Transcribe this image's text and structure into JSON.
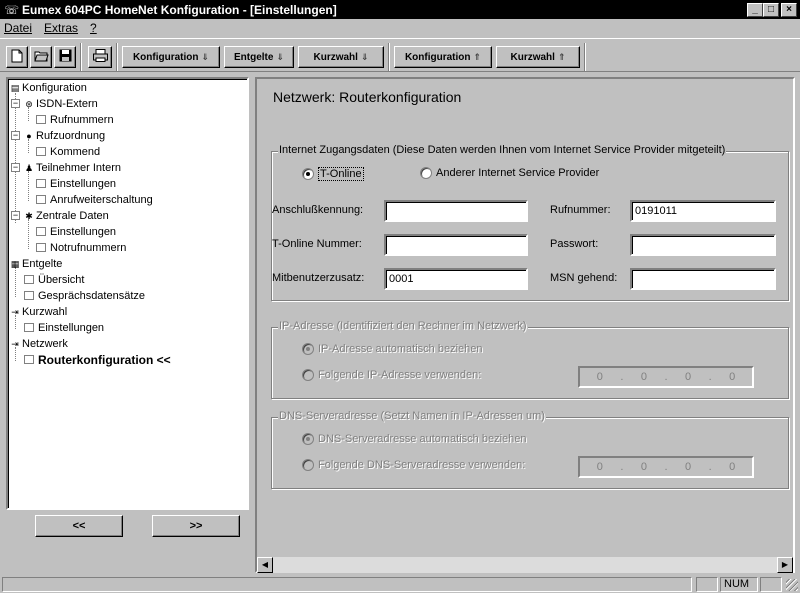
{
  "window": {
    "app_icon": "phone-icon",
    "title": "Eumex 604PC HomeNet Konfiguration - [Einstellungen]",
    "min_label": "_",
    "max_label": "□",
    "close_label": "×"
  },
  "menu": [
    "Datei",
    "Extras",
    "?"
  ],
  "toolbar": {
    "icons": [
      "new-document-icon",
      "open-folder-icon",
      "save-disk-icon",
      "print-icon"
    ],
    "buttons": [
      {
        "label": "Konfiguration",
        "arrow": "down"
      },
      {
        "label": "Entgelte",
        "arrow": "down"
      },
      {
        "label": "Kurzwahl",
        "arrow": "down"
      },
      {
        "label": "Konfiguration",
        "arrow": "up"
      },
      {
        "label": "Kurzwahl",
        "arrow": "up"
      }
    ]
  },
  "tree": {
    "items": [
      {
        "label": "Konfiguration"
      },
      {
        "label": "ISDN-Extern"
      },
      {
        "label": "Rufnummern"
      },
      {
        "label": "Rufzuordnung"
      },
      {
        "label": "Kommend"
      },
      {
        "label": "Teilnehmer Intern"
      },
      {
        "label": "Einstellungen"
      },
      {
        "label": "Anrufweiterschaltung"
      },
      {
        "label": "Zentrale Daten"
      },
      {
        "label": "Einstellungen"
      },
      {
        "label": "Notrufnummern"
      },
      {
        "label": "Entgelte"
      },
      {
        "label": "Übersicht"
      },
      {
        "label": "Gesprächsdatensätze"
      },
      {
        "label": "Kurzwahl"
      },
      {
        "label": "Einstellungen"
      },
      {
        "label": "Netzwerk"
      },
      {
        "label": "Routerkonfiguration <<"
      }
    ]
  },
  "nav": {
    "prev": "<<",
    "next": ">>"
  },
  "page": {
    "title": "Netzwerk: Routerkonfiguration",
    "internet": {
      "legend": "Internet Zugangsdaten (Diese Daten werden Ihnen vom Internet Service Provider mitgeteilt)",
      "opt_tonline": "T-Online",
      "opt_other": "Anderer Internet Service Provider",
      "selected": "T-Online",
      "anschluss_label": "Anschlußkennung:",
      "anschluss_value": "",
      "rufnummer_label": "Rufnummer:",
      "rufnummer_value": "0191011",
      "tonline_nr_label": "T-Online Nummer:",
      "tonline_nr_value": "",
      "passwort_label": "Passwort:",
      "passwort_value": "",
      "mitbenutzer_label": "Mitbenutzerzusatz:",
      "mitbenutzer_value": "0001",
      "msn_label": "MSN gehend:",
      "msn_value": ""
    },
    "ip": {
      "legend": "IP-Adresse (Identifiziert den Rechner im Netzwerk)",
      "opt_auto": "IP-Adresse automatisch beziehen",
      "opt_manual": "Folgende IP-Adresse verwenden:",
      "octets": [
        "0",
        "0",
        "0",
        "0"
      ]
    },
    "dns": {
      "legend": "DNS-Serveradresse (Setzt Namen in IP-Adressen um)",
      "opt_auto": "DNS-Serveradresse automatisch beziehen",
      "opt_manual": "Folgende DNS-Serveradresse verwenden:",
      "octets": [
        "0",
        "0",
        "0",
        "0"
      ]
    }
  },
  "status": {
    "num": "NUM"
  }
}
